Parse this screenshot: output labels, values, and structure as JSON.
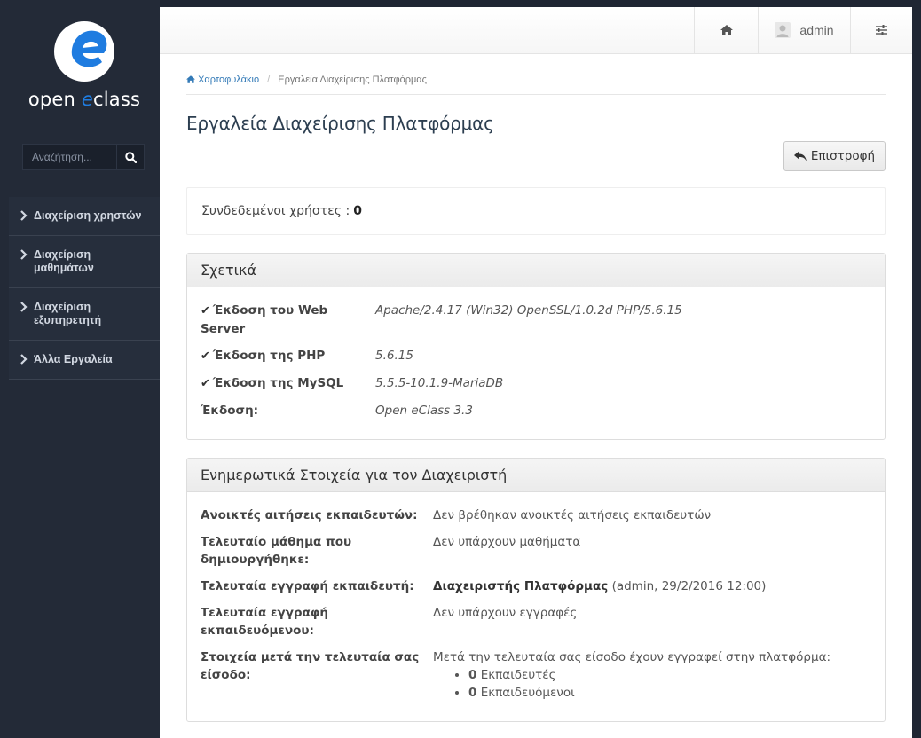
{
  "sidebar": {
    "logo": {
      "prefix": "open ",
      "accent": "e",
      "suffix": "class"
    },
    "search_placeholder": "Αναζήτηση...",
    "items": [
      {
        "label": "Διαχείριση χρηστών"
      },
      {
        "label": "Διαχείριση μαθημάτων"
      },
      {
        "label": "Διαχείριση εξυπηρετητή"
      },
      {
        "label": "Άλλα Εργαλεία"
      }
    ]
  },
  "topbar": {
    "user": "admin"
  },
  "breadcrumb": {
    "home": "Χαρτοφυλάκιο",
    "sep": "/",
    "current": "Εργαλεία Διαχείρισης Πλατφόρμας"
  },
  "page_title": "Εργαλεία Διαχείρισης Πλατφόρμας",
  "back_label": "Επιστροφή",
  "online": {
    "label": "Συνδεδεμένοι χρήστες :",
    "count": "0"
  },
  "about": {
    "title": "Σχετικά",
    "rows": [
      {
        "key": "Έκδοση του Web Server",
        "value": "Apache/2.4.17 (Win32) OpenSSL/1.0.2d PHP/5.6.15"
      },
      {
        "key": "Έκδοση της PHP",
        "value": "5.6.15"
      },
      {
        "key": "Έκδοση της MySQL",
        "value": "5.5.5-10.1.9-MariaDB"
      },
      {
        "key": "Έκδοση:",
        "value": "Open eClass 3.3"
      }
    ]
  },
  "info": {
    "title": "Ενημερωτικά Στοιχεία για τον Διαχειριστή",
    "rows": [
      {
        "key": "Ανοικτές αιτήσεις εκπαιδευτών:",
        "value": "Δεν βρέθηκαν ανοικτές αιτήσεις εκπαιδευτών"
      },
      {
        "key": "Τελευταίο μάθημα που δημιουργήθηκε:",
        "value": "Δεν υπάρχουν μαθήματα"
      },
      {
        "key": "Τελευταία εγγραφή εκπαιδευτή:",
        "value_bold": "Διαχειριστής Πλατφόρμας",
        "value_rest": " (admin, 29/2/2016 12:00)"
      },
      {
        "key": "Τελευταία εγγραφή εκπαιδευόμενου:",
        "value": "Δεν υπάρχουν εγγραφές"
      },
      {
        "key": "Στοιχεία μετά την τελευταία σας είσοδο:",
        "value": "Μετά την τελευταία σας είσοδο έχουν εγγραφεί στην πλατφόρμα:",
        "list": [
          {
            "count": "0",
            "label": " Εκπαιδευτές"
          },
          {
            "count": "0",
            "label": " Εκπαιδευόμενοι"
          }
        ]
      }
    ]
  },
  "colors": {
    "accent": "#1f7ce0",
    "sidebar": "#232a37",
    "link": "#337ab7"
  },
  "icons": [
    "logo-icon",
    "search-icon",
    "chevron-right-icon",
    "home-icon",
    "user-icon",
    "settings-icon",
    "reply-icon",
    "check-icon"
  ]
}
